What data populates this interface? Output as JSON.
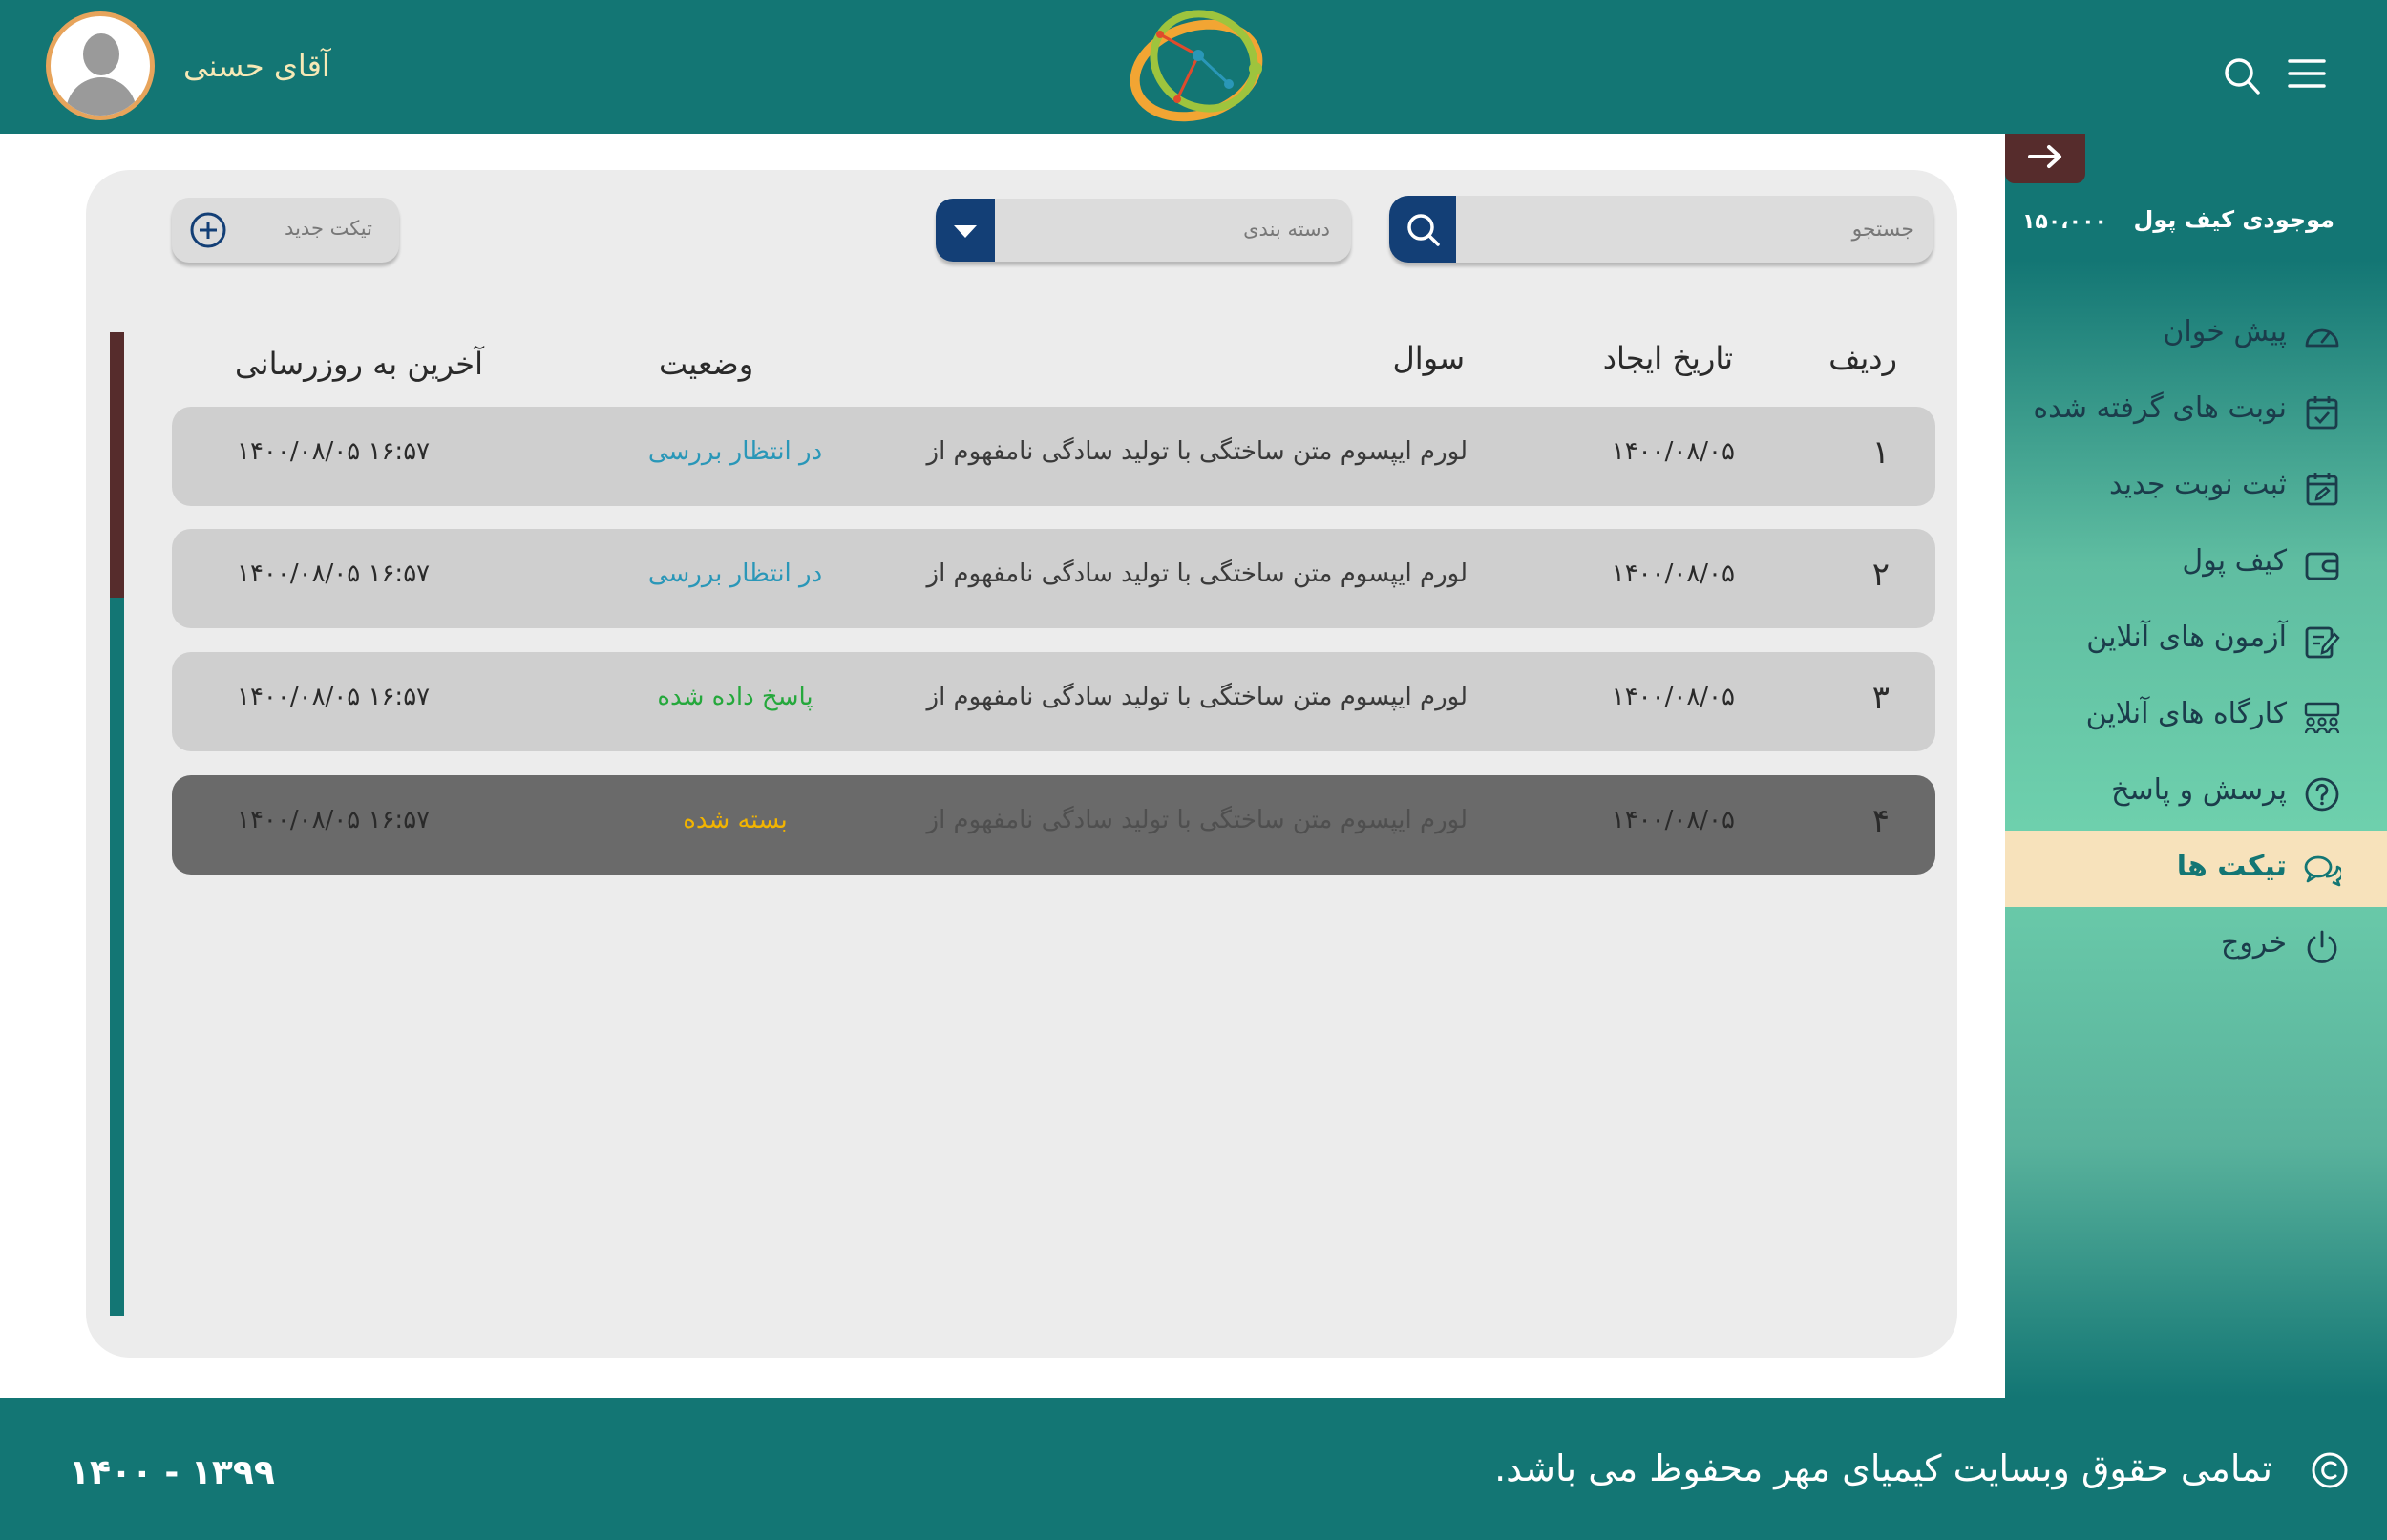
{
  "header": {
    "user_name": "آقای حسنی",
    "logo": "kimiaye-mehr-logo",
    "icons": [
      "search-icon",
      "hamburger-menu-icon",
      "avatar"
    ]
  },
  "sidebar": {
    "back_icon": "arrow-right-icon",
    "wallet_label": "موجودی کیف پول",
    "wallet_value": "۱۵۰،۰۰۰",
    "items": [
      {
        "label": "پیش خوان",
        "icon": "dashboard-gauge-icon"
      },
      {
        "label": "نوبت های گرفته شده",
        "icon": "calendar-check-icon"
      },
      {
        "label": "ثبت نوبت جدید",
        "icon": "calendar-edit-icon"
      },
      {
        "label": "کیف پول",
        "icon": "wallet-icon"
      },
      {
        "label": "آزمون های آنلاین",
        "icon": "exam-edit-icon"
      },
      {
        "label": "کارگاه های آنلاین",
        "icon": "workshop-group-icon"
      },
      {
        "label": "پرسش و پاسخ",
        "icon": "question-circle-icon"
      },
      {
        "label": "تیکت ها",
        "icon": "chat-bubbles-icon",
        "active": true
      },
      {
        "label": "خروج",
        "icon": "power-icon"
      }
    ]
  },
  "toolbar": {
    "search_placeholder": "جستجو",
    "category_label": "دسته بندی",
    "new_ticket_label": "تیکت جدید"
  },
  "table": {
    "headers": {
      "row": "ردیف",
      "created": "تاریخ ایجاد",
      "question": "سوال",
      "status": "وضعیت",
      "updated": "آخرین به روزرسانی"
    },
    "rows": [
      {
        "num": "۱",
        "created": "۱۴۰۰/۰۸/۰۵",
        "question": "لورم ایپسوم متن ساختگی با تولید سادگی نامفهوم از",
        "status": "در انتظار بررسی",
        "updated": "۱۴۰۰/۰۸/۰۵ ۱۶:۵۷"
      },
      {
        "num": "۲",
        "created": "۱۴۰۰/۰۸/۰۵",
        "question": "لورم ایپسوم متن ساختگی با تولید سادگی نامفهوم از",
        "status": "در انتظار بررسی",
        "updated": "۱۴۰۰/۰۸/۰۵ ۱۶:۵۷"
      },
      {
        "num": "۳",
        "created": "۱۴۰۰/۰۸/۰۵",
        "question": "لورم ایپسوم متن ساختگی با تولید سادگی نامفهوم از",
        "status": "پاسخ داده شده",
        "updated": "۱۴۰۰/۰۸/۰۵ ۱۶:۵۷"
      },
      {
        "num": "۴",
        "created": "۱۴۰۰/۰۸/۰۵",
        "question": "لورم ایپسوم متن ساختگی با تولید سادگی نامفهوم از",
        "status": "بسته شده",
        "updated": "۱۴۰۰/۰۸/۰۵ ۱۶:۵۷"
      }
    ]
  },
  "status_colors": {
    "pending": "#2a97b8",
    "answered": "#25a83c",
    "closed": "#f2b400"
  },
  "footer": {
    "copyright": "تمامی حقوق وبسایت کیمیای مهر محفوظ می باشد.",
    "years": "۱۴۰۰ - ۱۳۹۹",
    "icon": "copyright-icon"
  }
}
